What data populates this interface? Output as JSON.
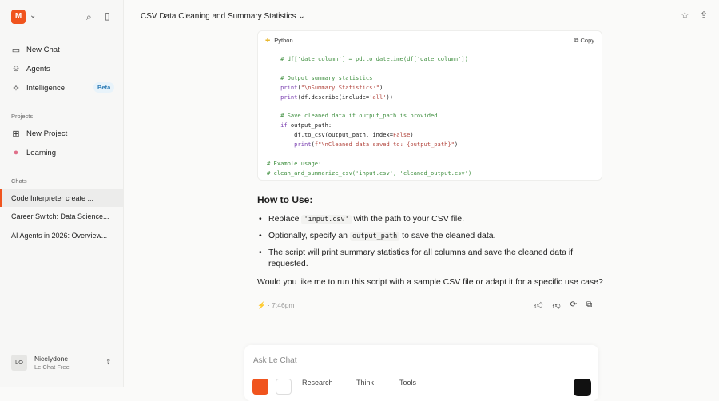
{
  "sidebar": {
    "logo": "M",
    "nav": [
      {
        "label": "New Chat",
        "icon": "chat-bubble-icon"
      },
      {
        "label": "Agents",
        "icon": "robot-icon"
      },
      {
        "label": "Intelligence",
        "icon": "sparkle-icon",
        "badge": "Beta"
      }
    ],
    "projects_label": "Projects",
    "projects": [
      {
        "label": "New Project",
        "icon": "folder-plus-icon"
      },
      {
        "label": "Learning",
        "icon": "brain-icon"
      }
    ],
    "chats_label": "Chats",
    "chats": [
      "Code Interpreter create ...",
      "Career Switch: Data Science...",
      "AI Agents in 2026: Overview..."
    ],
    "user": {
      "initials": "LO",
      "name": "Nicelydone",
      "plan": "Le Chat Free"
    }
  },
  "header": {
    "title": "CSV Data Cleaning and Summary Statistics"
  },
  "code_block": {
    "language": "Python",
    "copy_label": "Copy",
    "lines": [
      [
        [
          "    # df['date_column'] = pd.to_datetime(df['date_column'])",
          "cm"
        ]
      ],
      [],
      [
        [
          "    # Output summary statistics",
          "cm"
        ]
      ],
      [
        [
          "    ",
          "tx"
        ],
        [
          "print",
          "kw"
        ],
        [
          "(",
          "tx"
        ],
        [
          "\"\\nSummary Statistics:\"",
          "st"
        ],
        [
          ")",
          "tx"
        ]
      ],
      [
        [
          "    ",
          "tx"
        ],
        [
          "print",
          "kw"
        ],
        [
          "(df.describe(include=",
          "tx"
        ],
        [
          "'all'",
          "st"
        ],
        [
          "))",
          "tx"
        ]
      ],
      [],
      [
        [
          "    # Save cleaned data if output_path is provided",
          "cm"
        ]
      ],
      [
        [
          "    ",
          "tx"
        ],
        [
          "if",
          "kw"
        ],
        [
          " output_path:",
          "tx"
        ]
      ],
      [
        [
          "        df.to_csv(output_path, index=",
          "tx"
        ],
        [
          "False",
          "st"
        ],
        [
          ")",
          "tx"
        ]
      ],
      [
        [
          "        ",
          "tx"
        ],
        [
          "print",
          "kw"
        ],
        [
          "(",
          "tx"
        ],
        [
          "f\"\\nCleaned data saved to: {output_path}\"",
          "st"
        ],
        [
          ")",
          "tx"
        ]
      ],
      [],
      [
        [
          "# Example usage:",
          "cm"
        ]
      ],
      [
        [
          "# clean_and_summarize_csv('input.csv', 'cleaned_output.csv')",
          "cm"
        ]
      ]
    ]
  },
  "answer": {
    "heading": "How to Use:",
    "b1": {
      "a": "Replace ",
      "code": "'input.csv'",
      "b": " with the path to your CSV file."
    },
    "b2": {
      "a": "Optionally, specify an ",
      "code": "output_path",
      "b": " to save the cleaned data."
    },
    "b3": "The script will print summary statistics for all columns and save the cleaned data if requested.",
    "question": "Would you like me to run this script with a sample CSV file or adapt it for a specific use case?",
    "time": "7:46pm"
  },
  "composer": {
    "placeholder": "Ask Le Chat",
    "tools": [
      "Research",
      "Think",
      "Tools"
    ]
  }
}
